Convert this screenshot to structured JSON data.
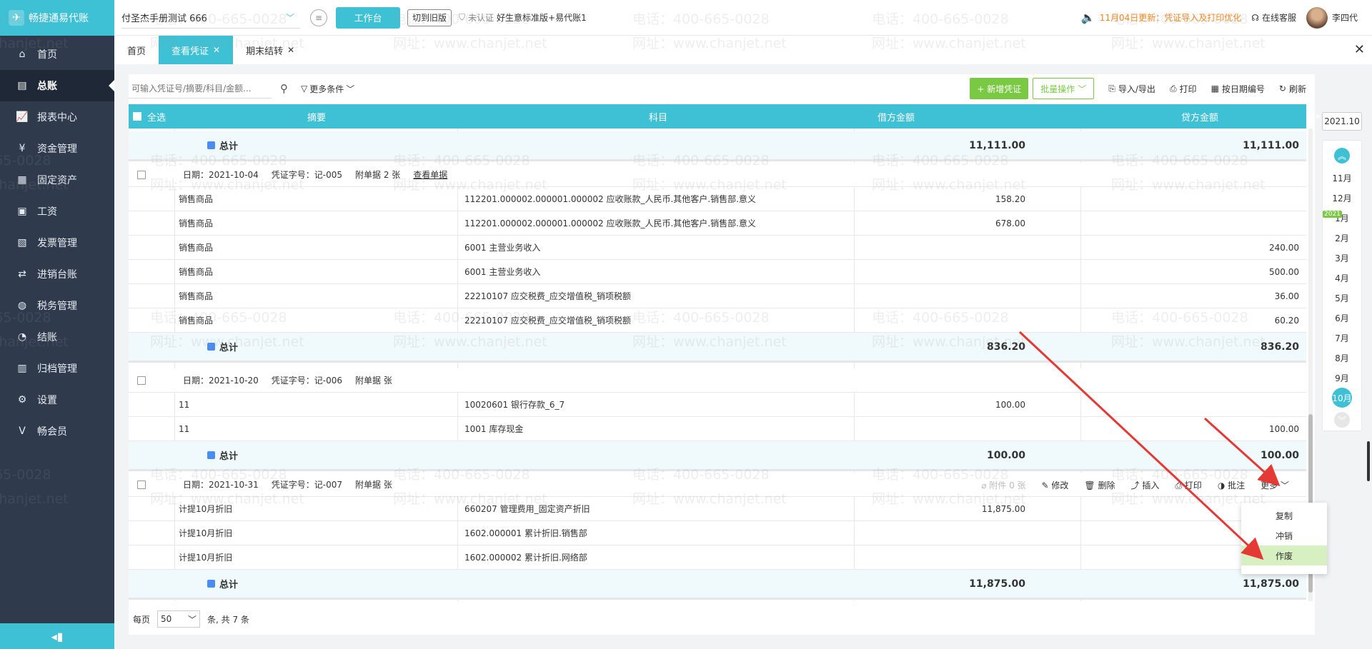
{
  "app": {
    "brand": "畅捷通易代账"
  },
  "sidebar": {
    "items": [
      {
        "label": "首页",
        "icon": "home-icon"
      },
      {
        "label": "总账",
        "icon": "ledger-icon"
      },
      {
        "label": "报表中心",
        "icon": "chart-icon"
      },
      {
        "label": "资金管理",
        "icon": "money-icon"
      },
      {
        "label": "固定资产",
        "icon": "asset-icon"
      },
      {
        "label": "工资",
        "icon": "salary-icon"
      },
      {
        "label": "发票管理",
        "icon": "invoice-icon"
      },
      {
        "label": "进销台账",
        "icon": "stock-icon"
      },
      {
        "label": "税务管理",
        "icon": "tax-icon"
      },
      {
        "label": "结账",
        "icon": "close-period-icon"
      },
      {
        "label": "归档管理",
        "icon": "archive-icon"
      },
      {
        "label": "设置",
        "icon": "gear-icon"
      },
      {
        "label": "畅会员",
        "icon": "vip-icon"
      }
    ],
    "active_index": 1
  },
  "header": {
    "company": "付圣杰手册测试 666",
    "workbench_label": "工作台",
    "old_version_label": "切到旧版",
    "auth_status": "未认证",
    "plan": "好生意标准版+易代账1",
    "notice": "11月04日更新：凭证导入及打印优化",
    "service_label": "在线客服",
    "user_name": "李四代"
  },
  "tabs": [
    {
      "label": "首页",
      "closable": false,
      "active": false
    },
    {
      "label": "查看凭证",
      "closable": true,
      "active": true
    },
    {
      "label": "期末结转",
      "closable": true,
      "active": false
    }
  ],
  "toolbar": {
    "search_placeholder": "可输入凭证号/摘要/科目/金额...",
    "more_filters": "更多条件",
    "new_voucher": "+ 新增凭证",
    "batch": "批量操作",
    "import_export": "导入/导出",
    "print": "打印",
    "renumber": "按日期编号",
    "refresh": "刷新"
  },
  "table": {
    "headers": {
      "select_all": "全选",
      "summary": "摘要",
      "subject": "科目",
      "debit": "借方金额",
      "credit": "贷方金额"
    }
  },
  "vouchers": {
    "v0_total": {
      "label": "总计",
      "debit": "11,111.00",
      "credit": "11,111.00"
    },
    "v1": {
      "meta": {
        "date": "日期：2021-10-04",
        "number": "凭证字号：记-005",
        "attach": "附单据 2 张",
        "view": "查看单据"
      },
      "lines": [
        {
          "summary": "销售商品",
          "subject": "112201.000002.000001.000002  应收账款_人民币.其他客户.销售部.意义",
          "debit": "158.20",
          "credit": ""
        },
        {
          "summary": "销售商品",
          "subject": "112201.000002.000001.000002  应收账款_人民币.其他客户.销售部.意义",
          "debit": "678.00",
          "credit": ""
        },
        {
          "summary": "销售商品",
          "subject": "6001 主营业务收入",
          "debit": "",
          "credit": "240.00"
        },
        {
          "summary": "销售商品",
          "subject": "6001 主营业务收入",
          "debit": "",
          "credit": "500.00"
        },
        {
          "summary": "销售商品",
          "subject": "22210107 应交税费_应交增值税_销项税额",
          "debit": "",
          "credit": "36.00"
        },
        {
          "summary": "销售商品",
          "subject": "22210107 应交税费_应交增值税_销项税额",
          "debit": "",
          "credit": "60.20"
        }
      ],
      "total": {
        "label": "总计",
        "debit": "836.20",
        "credit": "836.20"
      }
    },
    "v2": {
      "meta": {
        "date": "日期：2021-10-20",
        "number": "凭证字号：记-006",
        "attach": "附单据  张"
      },
      "lines": [
        {
          "summary": "11",
          "subject": "10020601 银行存款_6_7",
          "debit": "100.00",
          "credit": ""
        },
        {
          "summary": "11",
          "subject": "1001 库存现金",
          "debit": "",
          "credit": "100.00"
        }
      ],
      "total": {
        "label": "总计",
        "debit": "100.00",
        "credit": "100.00"
      }
    },
    "v3": {
      "meta": {
        "date": "日期：2021-10-31",
        "number": "凭证字号：记-007",
        "attach": "附单据  张"
      },
      "actions": {
        "attach": "附件 0 张",
        "edit": "修改",
        "delete": "删除",
        "insert": "插入",
        "print": "打印",
        "note": "批注",
        "more": "更多"
      },
      "lines": [
        {
          "summary": "计提10月折旧",
          "subject": "660207 管理费用_固定资产折旧",
          "debit": "11,875.00",
          "credit": ""
        },
        {
          "summary": "计提10月折旧",
          "subject": "1602.000001  累计折旧.销售部",
          "debit": "",
          "credit": ""
        },
        {
          "summary": "计提10月折旧",
          "subject": "1602.000002  累计折旧.网络部",
          "debit": "",
          "credit": ""
        }
      ],
      "total": {
        "label": "总计",
        "debit": "11,875.00",
        "credit": "11,875.00"
      }
    }
  },
  "more_menu": {
    "copy": "复制",
    "reverse": "冲销",
    "void": "作废"
  },
  "pager": {
    "per_page_label": "每页",
    "per_page": "50",
    "summary": "条, 共 7 条"
  },
  "period": {
    "year_input": "2021.10",
    "year_tag": "2021",
    "months_prev": [
      "11月",
      "12月"
    ],
    "months": [
      "1月",
      "2月",
      "3月",
      "4月",
      "5月",
      "6月",
      "7月",
      "8月",
      "9月"
    ],
    "selected": "10月"
  },
  "watermark": {
    "phone": "电话：400-665-0028",
    "site": "网址：www.chanjet.net"
  },
  "colors": {
    "accent": "#3ec1d5",
    "sidebar": "#2f3a4c",
    "green": "#7ac943",
    "notice": "#f5871f",
    "arrow": "#e53935"
  }
}
